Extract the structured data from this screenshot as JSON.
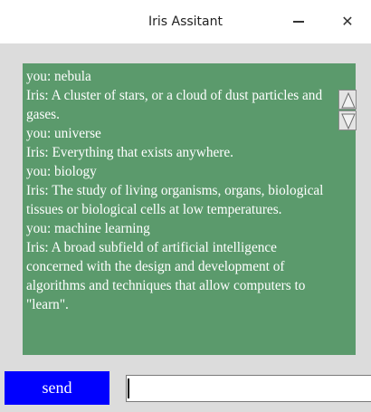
{
  "window": {
    "title": "Iris Assitant",
    "minimize_glyph": "—",
    "close_glyph": "✕"
  },
  "chat": {
    "lines": [
      "you: nebula",
      "Iris: A cluster of stars, or a cloud of dust particles and",
      "gases.",
      "you: universe",
      "Iris: Everything that exists anywhere.",
      "you: biology",
      "Iris: The study of living organisms, organs, biological",
      "tissues or biological cells at low temperatures.",
      "you: machine learning",
      "Iris: A broad subfield of artificial intelligence",
      "concerned with the design and development of",
      "algorithms and techniques that allow computers to",
      "\"learn\"."
    ]
  },
  "controls": {
    "send_label": "send",
    "input_value": ""
  },
  "colors": {
    "chat_background": "#5b9a6c",
    "send_button": "#0000ff",
    "window_background": "#dcdcdc"
  }
}
